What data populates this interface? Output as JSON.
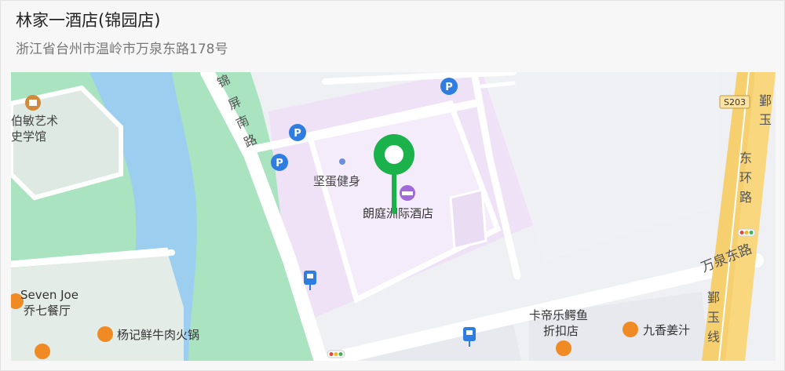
{
  "hotel": {
    "name": "林家一酒店(锦园店)",
    "address": "浙江省台州市温岭市万泉东路178号"
  },
  "map": {
    "pois": [
      {
        "label_1": "伯敏艺术",
        "label_2": "史学馆",
        "icon": "museum-icon"
      },
      {
        "label": "坚蛋健身",
        "icon": "dot-icon"
      },
      {
        "label": "朗庭洲际酒店",
        "icon": "hotel-bed-icon"
      },
      {
        "label_1": "Seven Joe",
        "label_2": "乔七餐厅",
        "icon": "restaurant-icon"
      },
      {
        "label": "杨记鲜牛肉火锅",
        "icon": "restaurant-icon"
      },
      {
        "label_1": "卡帝乐鳄鱼",
        "label_2": "折扣店",
        "icon": "shopping-icon"
      },
      {
        "label": "九香姜汁",
        "icon": "restaurant-icon"
      }
    ],
    "roads": {
      "jinping": [
        "锦",
        "屏",
        "南",
        "路"
      ],
      "donghuan": [
        "东",
        "环",
        "路"
      ],
      "wanquan": "万泉东路",
      "yinyu_1": [
        "鄞",
        "玉"
      ],
      "yinyu_2": [
        "鄞",
        "玉",
        "线"
      ],
      "shield": "S203"
    },
    "marker_color": "#1bb24b",
    "colors": {
      "water": "#9ccfef",
      "park": "#a9e3c0",
      "campus": "#f0e4f8",
      "highway": "#f6cf6f"
    }
  }
}
